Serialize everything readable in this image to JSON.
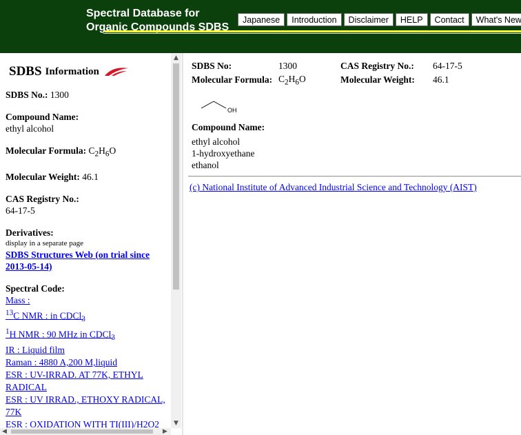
{
  "header": {
    "title_line1": "Spectral Database for",
    "title_line2": "Organic Compounds SDBS",
    "nav": [
      {
        "label": "Japanese"
      },
      {
        "label": "Introduction"
      },
      {
        "label": "Disclaimer"
      },
      {
        "label": "HELP"
      },
      {
        "label": "Contact"
      },
      {
        "label": "What's New"
      }
    ],
    "colors": {
      "background": "#0b3f0b",
      "accent_line": "#ffff33"
    }
  },
  "left": {
    "heading_big": "SDBS",
    "heading_small": "Information",
    "sdbs_no_label": "SDBS No.:",
    "sdbs_no": "1300",
    "compound_name_label": "Compound Name:",
    "compound_name": "ethyl alcohol",
    "formula_label": "Molecular Formula:",
    "formula": {
      "c": "C",
      "c_n": "2",
      "h": "H",
      "h_n": "6",
      "o": "O"
    },
    "weight_label": "Molecular Weight:",
    "weight": "46.1",
    "cas_label": "CAS Registry No.:",
    "cas": "64-17-5",
    "derivatives_label": "Derivatives:",
    "derivatives_note": "display in a separate page",
    "structures_link": "SDBS Structures Web (on trial since 2013-05-14)",
    "spectral_label": "Spectral Code:",
    "spectra": {
      "mass": "Mass :",
      "c13_sup": "13",
      "c13_text": "C NMR : in CDCl",
      "c13_sub": "3",
      "h1_sup": "1",
      "h1_text": "H NMR : 90 MHz in CDCl",
      "h1_sub": "3",
      "ir": "IR : Liquid film",
      "raman": "Raman : 4880 A,200 M,liquid",
      "esr1": "ESR : UV-IRRAD. AT 77K, ETHYL RADICAL",
      "esr2": "ESR : UV IRRAD., ETHOXY RADICAL, 77K",
      "esr3": "ESR : OXIDATION WITH TI(III)/H2O2"
    }
  },
  "right": {
    "sdbs_no_label": "SDBS No:",
    "sdbs_no": "1300",
    "cas_label": "CAS Registry No.:",
    "cas": "64-17-5",
    "formula_label": "Molecular Formula:",
    "weight_label": "Molecular Weight:",
    "weight": "46.1",
    "structure_oh": "OH",
    "compound_name_label": "Compound Name:",
    "names": [
      "ethyl alcohol",
      "1-hydroxyethane",
      "ethanol"
    ],
    "copyright": "(c) National Institute of Advanced Industrial Science and Technology (AIST)"
  }
}
